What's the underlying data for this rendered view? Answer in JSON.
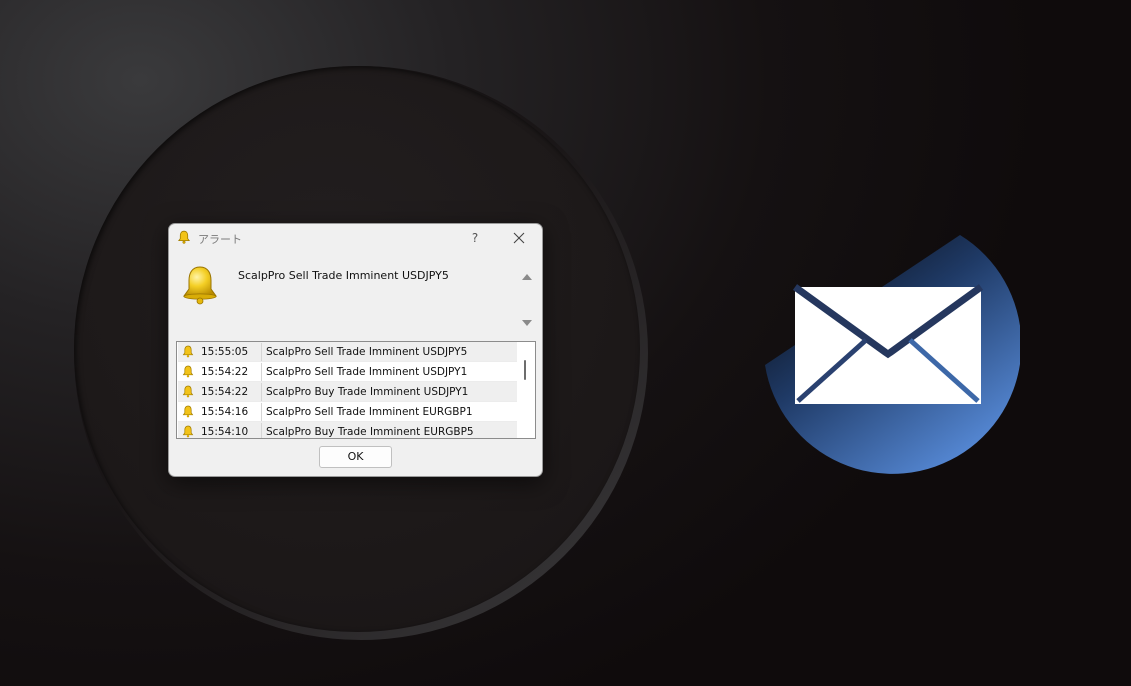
{
  "dialog": {
    "title": "アラート",
    "help_label": "?",
    "message": "ScalpPro Sell Trade Imminent USDJPY5",
    "ok_label": "OK",
    "alerts": [
      {
        "time": "15:55:05",
        "text": "ScalpPro Sell Trade Imminent USDJPY5"
      },
      {
        "time": "15:54:22",
        "text": "ScalpPro Sell Trade Imminent USDJPY1"
      },
      {
        "time": "15:54:22",
        "text": "ScalpPro Buy Trade Imminent USDJPY1"
      },
      {
        "time": "15:54:16",
        "text": "ScalpPro Sell Trade Imminent EURGBP1"
      },
      {
        "time": "15:54:10",
        "text": "ScalpPro Buy Trade Imminent EURGBP5"
      }
    ]
  },
  "icons": {
    "title": "bell-icon",
    "message": "bell-icon",
    "decoration": "mail-icon"
  },
  "colors": {
    "bell": "#f2c318",
    "mail_disc": "#4f86d6",
    "dialog_bg": "#f0f0f0"
  }
}
